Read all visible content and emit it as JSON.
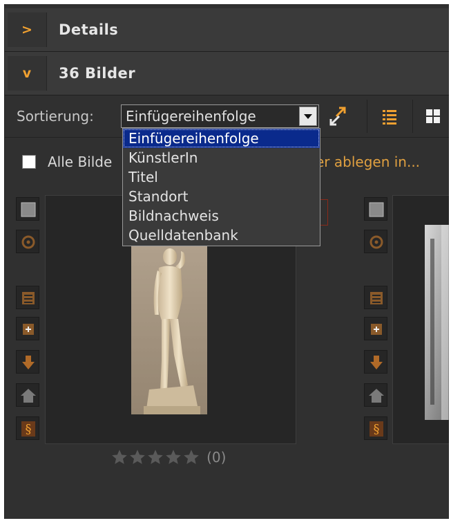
{
  "sections": {
    "details": {
      "chevron": ">",
      "title": "Details"
    },
    "images": {
      "chevron": "v",
      "title": "36 Bilder"
    }
  },
  "toolbar": {
    "sort_label": "Sortierung:",
    "sort_value": "Einfügereihenfolge",
    "sort_options": [
      "Einfügereihenfolge",
      "KünstlerIn",
      "Titel",
      "Standort",
      "Bildnachweis",
      "Quelldatenbank"
    ],
    "icons": [
      "reverse-sort-icon",
      "list-view-icon",
      "grid-view-icon"
    ]
  },
  "selection": {
    "select_all_label": "Alle Bilde",
    "folder_action": "er ablegen in..."
  },
  "card": {
    "rating_count": "(0)",
    "rating_value": 0,
    "rating_max": 5
  },
  "colors": {
    "accent": "#f0a030",
    "panel": "#303030",
    "dropdown_selected": "#0a2a8c"
  }
}
